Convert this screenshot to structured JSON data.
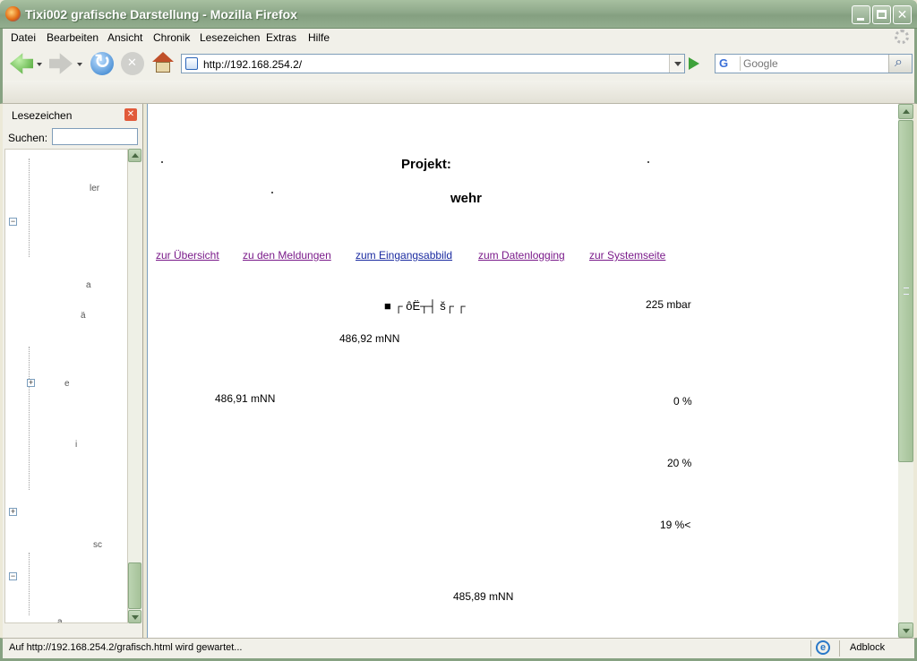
{
  "window": {
    "title": "Tixi002 grafische Darstellung - Mozilla Firefox"
  },
  "menu": [
    "Datei",
    "Bearbeiten",
    "Ansicht",
    "Chronik",
    "Lesezeichen",
    "Extras",
    "Hilfe"
  ],
  "navbar": {
    "url": "http://192.168.254.2/",
    "search_placeholder": "Google"
  },
  "sidebar": {
    "title": "Lesezeichen",
    "search_label": "Suchen:",
    "fragments": [
      "ler",
      "a",
      "ä",
      "e",
      "i",
      "sc",
      "a"
    ]
  },
  "content": {
    "heading1": "Projekt:",
    "heading2": "wehr",
    "links": [
      "zur Übersicht",
      "zu den Meldungen",
      "zum Eingangsabbild",
      "zum Datenlogging",
      "zur Systemseite"
    ],
    "garbled": "■ ┌ ôË┬┤ š┌ ┌",
    "pressure": "225 mbar",
    "level1": "486,92 mNN",
    "level2": "486,91 mNN",
    "pct1": "0 %",
    "pct2": "20 %",
    "pct3": "19 %<",
    "level3": "485,89 mNN"
  },
  "status": {
    "message": "Auf http://192.168.254.2/grafisch.html wird gewartet...",
    "addon": "Adblock"
  }
}
